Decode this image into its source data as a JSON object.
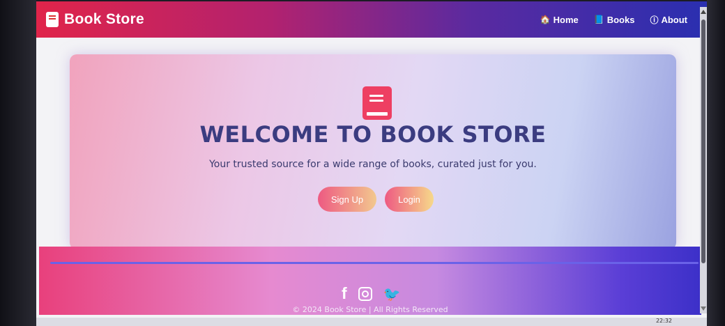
{
  "navbar": {
    "brand": "Book Store",
    "links": [
      {
        "icon": "home-icon",
        "glyph": "🏠",
        "label": "Home"
      },
      {
        "icon": "book-icon",
        "glyph": "📘",
        "label": "Books"
      },
      {
        "icon": "info-icon",
        "glyph": "ⓘ",
        "label": "About"
      }
    ]
  },
  "hero": {
    "title": "WELCOME TO BOOK STORE",
    "subtitle": "Your trusted source for a wide range of books, curated just for you.",
    "signup_label": "Sign Up",
    "login_label": "Login"
  },
  "footer": {
    "social": [
      "facebook-icon",
      "instagram-icon",
      "twitter-icon"
    ],
    "copyright": "© 2024 Book Store | All Rights Reserved"
  },
  "taskbar": {
    "clock": "22:32"
  },
  "colors": {
    "accent_red": "#e0244a",
    "accent_blue": "#2a2fb0",
    "title_text": "#3b3c80"
  }
}
